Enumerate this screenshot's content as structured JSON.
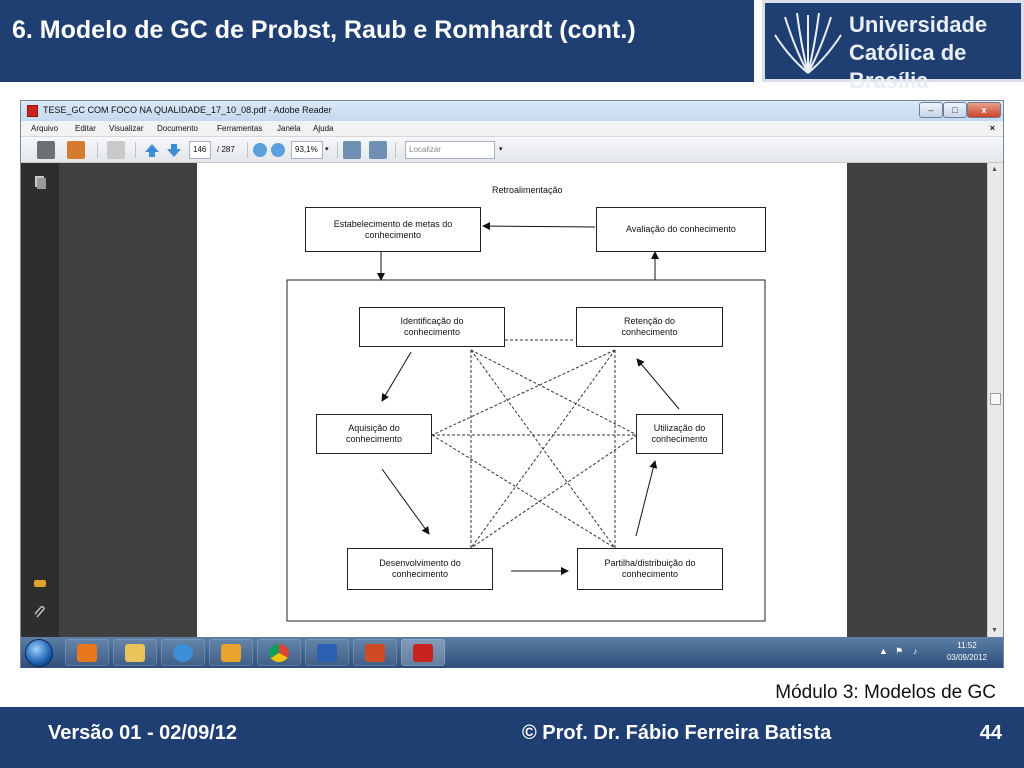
{
  "slide": {
    "title": "6. Modelo de GC de Probst, Raub e Romhardt (cont.)",
    "logo": {
      "line1": "Universidade",
      "line2": "Católica de Brasília"
    },
    "module": "Módulo 3: Modelos de GC",
    "footer": {
      "version": "Versão 01  -  02/09/12",
      "author": "©  Prof. Dr. Fábio Ferreira Batista",
      "page": "44"
    }
  },
  "window": {
    "title": "TESE_GC COM FOCO NA QUALIDADE_17_10_08.pdf - Adobe Reader",
    "buttons": {
      "minimize": "–",
      "maximize": "□",
      "close": "x"
    }
  },
  "menu": {
    "items": [
      "Arquivo",
      "Editar",
      "Visualizar",
      "Documento",
      "Ferramentas",
      "Janela",
      "Ajuda"
    ],
    "close": "×"
  },
  "toolbar": {
    "page_current": "146",
    "page_total": "/ 287",
    "zoom": "93,1%",
    "search_placeholder": "Localizar"
  },
  "diagram": {
    "caption": "Retroalimentação",
    "boxes": {
      "metas": "Estabelecimento de metas do conhecimento",
      "avaliacao": "Avaliação do conhecimento",
      "identificacao": "Identificação do conhecimento",
      "retencao": "Retenção do conhecimento",
      "aquisicao": "Aquisição do conhecimento",
      "utilizacao": "Utilização do conhecimento",
      "desenvolvimento": "Desenvolvimento do conhecimento",
      "partilha": "Partilha/distribuição do conhecimento"
    }
  },
  "taskbar": {
    "time": "11:52",
    "date": "03/09/2012"
  },
  "colors": {
    "brand_blue": "#1f3f73",
    "pdf_red": "#c8231e"
  }
}
